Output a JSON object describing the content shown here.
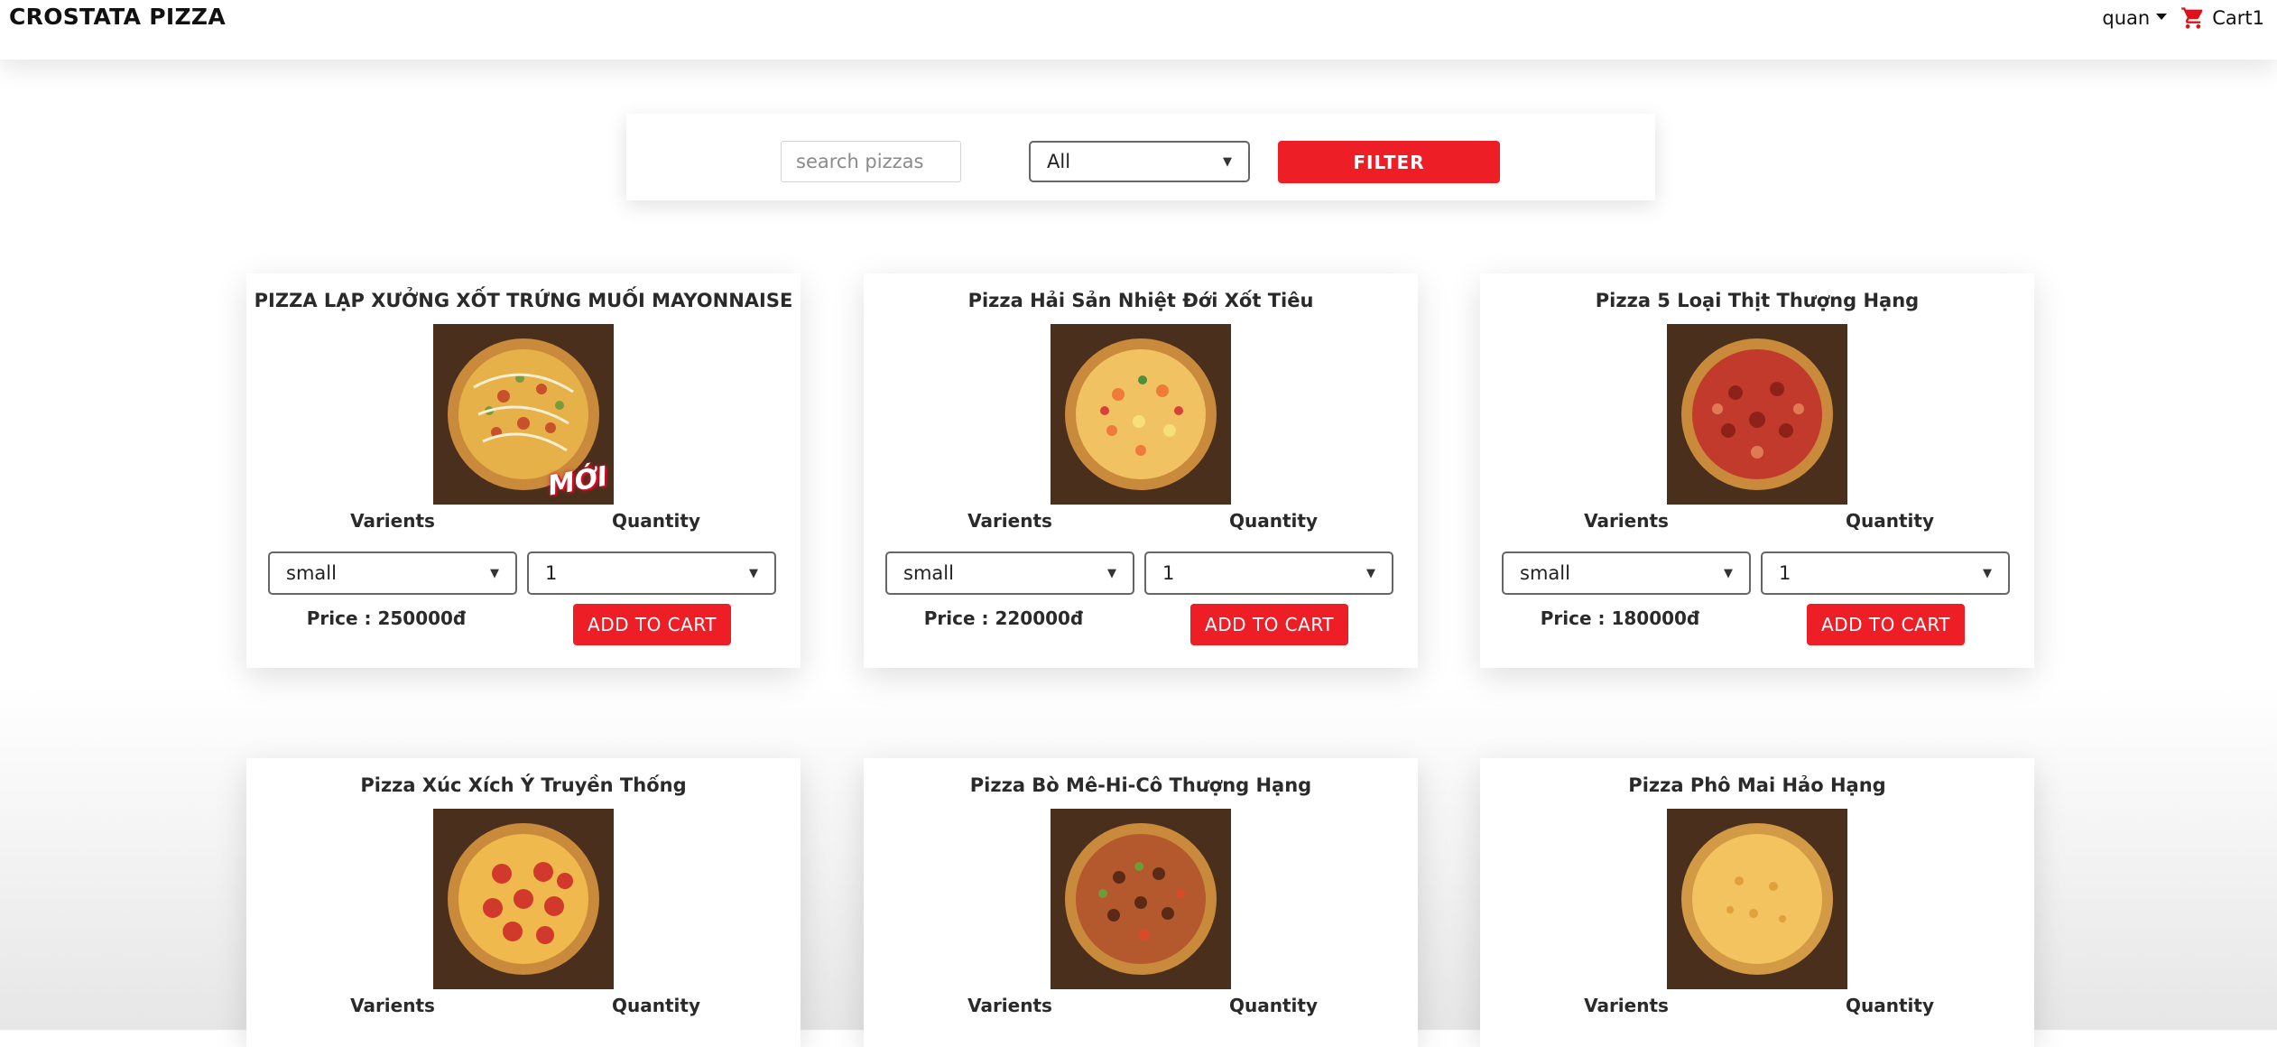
{
  "navbar": {
    "brand": "CROSTATA PIZZA",
    "user": "quan",
    "cart_label": "Cart",
    "cart_count": "1"
  },
  "filter": {
    "search_placeholder": "search pizzas",
    "category_selected": "All",
    "filter_button": "FILTER"
  },
  "labels": {
    "varients": "Varients",
    "quantity": "Quantity",
    "add_to_cart": "ADD TO CART"
  },
  "pizzas": [
    {
      "name": "PIZZA LẠP XƯỞNG XỐT TRỨNG MUỐI MAYONNAISE",
      "varient": "small",
      "quantity": "1",
      "price": "Price : 250000đ",
      "badge": "MỚI"
    },
    {
      "name": "Pizza Hải Sản Nhiệt Đới Xốt Tiêu",
      "varient": "small",
      "quantity": "1",
      "price": "Price : 220000đ"
    },
    {
      "name": "Pizza 5 Loại Thịt Thượng Hạng",
      "varient": "small",
      "quantity": "1",
      "price": "Price : 180000đ"
    },
    {
      "name": "Pizza Xúc Xích Ý Truyền Thống"
    },
    {
      "name": "Pizza Bò Mê-Hi-Cô Thượng Hạng"
    },
    {
      "name": "Pizza Phô Mai Hảo Hạng"
    }
  ],
  "colors": {
    "accent": "#ee1e27",
    "board": "#4a2f1c"
  }
}
